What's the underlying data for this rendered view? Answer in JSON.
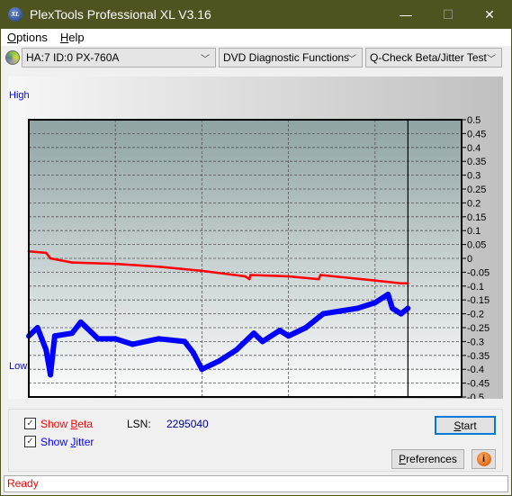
{
  "window": {
    "title": "PlexTools Professional XL V3.16",
    "logo_text": "XL",
    "minimize": "—",
    "maximize": "☐",
    "close": "✕"
  },
  "menu": [
    {
      "label": "Options",
      "u": "O",
      "rest": "ptions"
    },
    {
      "label": "Help",
      "u": "H",
      "rest": "elp"
    }
  ],
  "toolbar": {
    "drive": "HA:7 ID:0  PX-760A",
    "function": "DVD Diagnostic Functions",
    "test": "Q-Check Beta/Jitter Test"
  },
  "chart_labels": {
    "high": "High",
    "low": "Low"
  },
  "chart_data": {
    "type": "line",
    "xlim": [
      0,
      5
    ],
    "ylim": [
      -0.5,
      0.5
    ],
    "x_ticks": [
      "0",
      "1",
      "2",
      "3",
      "4",
      "5"
    ],
    "y_ticks": [
      "0.5",
      "0.45",
      "0.4",
      "0.35",
      "0.3",
      "0.25",
      "0.2",
      "0.15",
      "0.1",
      "0.05",
      "0",
      "-0.05",
      "-0.1",
      "-0.15",
      "-0.2",
      "-0.25",
      "-0.3",
      "-0.35",
      "-0.4",
      "-0.45",
      "-0.5"
    ],
    "grid": true,
    "cursor_x": 4.38,
    "colors": {
      "beta": "#ff0000",
      "jitter": "#0000ff"
    },
    "series": [
      {
        "key": "beta",
        "x": [
          0,
          0.2,
          0.25,
          0.5,
          1.0,
          1.5,
          2.0,
          2.5,
          2.55,
          2.56,
          3.0,
          3.35,
          3.37,
          4.0,
          4.3,
          4.38
        ],
        "y": [
          0.025,
          0.02,
          0.0,
          -0.015,
          -0.02,
          -0.03,
          -0.045,
          -0.065,
          -0.075,
          -0.06,
          -0.065,
          -0.075,
          -0.06,
          -0.08,
          -0.09,
          -0.09
        ]
      },
      {
        "key": "jitter",
        "x": [
          0,
          0.1,
          0.2,
          0.25,
          0.3,
          0.5,
          0.6,
          0.8,
          1.0,
          1.2,
          1.5,
          1.8,
          1.9,
          2.0,
          2.2,
          2.4,
          2.6,
          2.7,
          2.9,
          3.0,
          3.2,
          3.4,
          3.6,
          3.8,
          4.0,
          4.15,
          4.2,
          4.3,
          4.38
        ],
        "y": [
          -0.28,
          -0.25,
          -0.33,
          -0.42,
          -0.28,
          -0.27,
          -0.23,
          -0.29,
          -0.29,
          -0.31,
          -0.29,
          -0.3,
          -0.34,
          -0.4,
          -0.37,
          -0.33,
          -0.27,
          -0.3,
          -0.26,
          -0.28,
          -0.25,
          -0.2,
          -0.19,
          -0.18,
          -0.16,
          -0.13,
          -0.18,
          -0.2,
          -0.18
        ]
      }
    ]
  },
  "controls": {
    "show_beta": "Show Beta",
    "show_beta_pre": "Show ",
    "show_beta_u": "B",
    "show_beta_rest": "eta",
    "show_jitter_pre": "Show ",
    "show_jitter_u": "J",
    "show_jitter_rest": "itter",
    "show_beta_checked": true,
    "show_jitter_checked": true,
    "lsn_label": "LSN:",
    "lsn_value": "2295040",
    "start": "Start",
    "start_u": "S",
    "start_rest": "tart",
    "preferences_u": "P",
    "preferences_rest": "references",
    "info_icon": "info-icon"
  },
  "status": "Ready"
}
